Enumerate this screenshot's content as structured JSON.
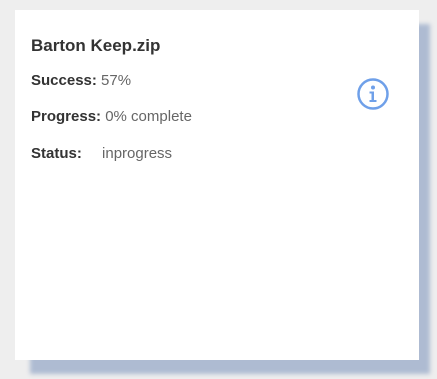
{
  "card": {
    "title": "Barton Keep.zip",
    "success_label": "Success:",
    "success_value": "57%",
    "progress_label": "Progress:",
    "progress_value": "0% complete",
    "status_label": "Status:",
    "status_value": "inprogress",
    "icon": "info-icon",
    "icon_color": "#6fa0e9"
  }
}
